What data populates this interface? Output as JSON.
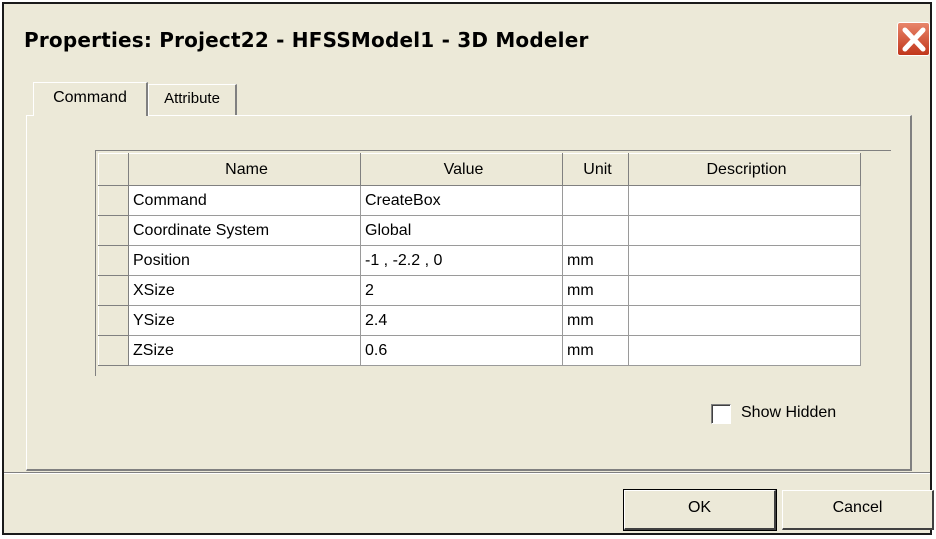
{
  "dialog": {
    "title": "Properties: Project22 - HFSSModel1 - 3D Modeler",
    "tabs": [
      {
        "label": "Command",
        "active": true
      },
      {
        "label": "Attribute",
        "active": false
      }
    ],
    "grid": {
      "headers": [
        "Name",
        "Value",
        "Unit",
        "Description"
      ],
      "rows": [
        {
          "name": "Command",
          "value": "CreateBox",
          "unit": "",
          "description": ""
        },
        {
          "name": "Coordinate System",
          "value": "Global",
          "unit": "",
          "description": ""
        },
        {
          "name": "Position",
          "value": "-1 , -2.2 , 0",
          "unit": "mm",
          "description": ""
        },
        {
          "name": "XSize",
          "value": "2",
          "unit": "mm",
          "description": ""
        },
        {
          "name": "YSize",
          "value": "2.4",
          "unit": "mm",
          "description": ""
        },
        {
          "name": "ZSize",
          "value": "0.6",
          "unit": "mm",
          "description": ""
        }
      ]
    },
    "show_hidden_label": "Show Hidden",
    "show_hidden_checked": false,
    "ok_label": "OK",
    "cancel_label": "Cancel"
  },
  "colors": {
    "dialog_bg": "#ece9d8",
    "close_button": "#c1361b"
  },
  "icons": {
    "close": "close-icon"
  }
}
